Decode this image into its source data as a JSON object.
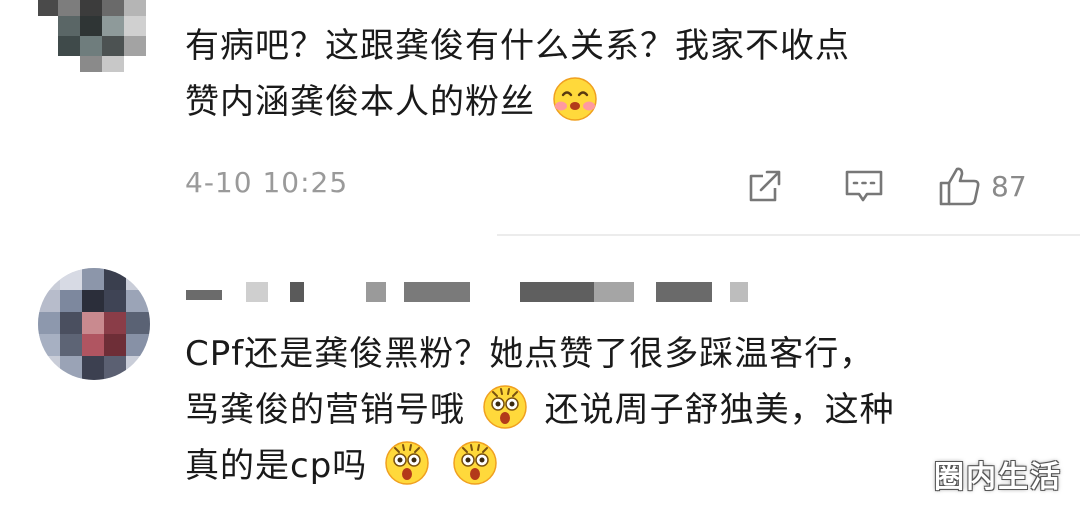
{
  "comments": [
    {
      "lines": [
        "有病吧？这跟龚俊有什么关系？我家不收点",
        "赞内涵龚俊本人的粉丝"
      ],
      "line2_emoji": "blushing-face",
      "time": "4-10 10:25",
      "likes": "87"
    },
    {
      "lines": [
        "CPf还是龚俊黑粉？她点赞了很多踩温客行，",
        "骂龚俊的营销号哦",
        "还说周子舒独美，这种",
        "真的是cp吗"
      ],
      "emoji": "astonished-face"
    }
  ],
  "icons": {
    "share": "share-icon",
    "reply": "comment-icon",
    "like": "thumbs-up-icon"
  },
  "watermark": "圈内生活"
}
